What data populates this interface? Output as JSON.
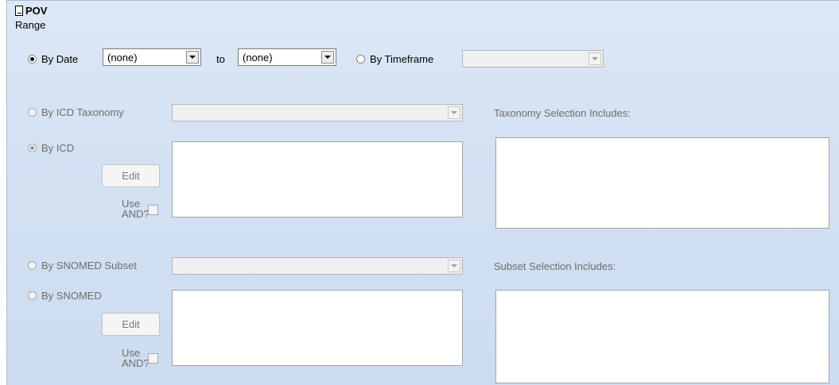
{
  "panel": {
    "title": "POV",
    "range_label": "Range"
  },
  "date_range": {
    "by_date_label": "By Date",
    "from_value": "(none)",
    "to_label": "to",
    "to_value": "(none)",
    "by_timeframe_label": "By Timeframe",
    "timeframe_value": ""
  },
  "icd": {
    "taxonomy_label": "By ICD Taxonomy",
    "taxonomy_value": "",
    "by_icd_label": "By ICD",
    "edit_label": "Edit",
    "use_and_line1": "Use",
    "use_and_line2": "AND?",
    "selection_label": "Taxonomy Selection Includes:"
  },
  "snomed": {
    "subset_label": "By SNOMED Subset",
    "subset_value": "",
    "by_snomed_label": "By SNOMED",
    "edit_label": "Edit",
    "use_and_line1": "Use",
    "use_and_line2": "AND?",
    "selection_label": "Subset Selection Includes:"
  }
}
